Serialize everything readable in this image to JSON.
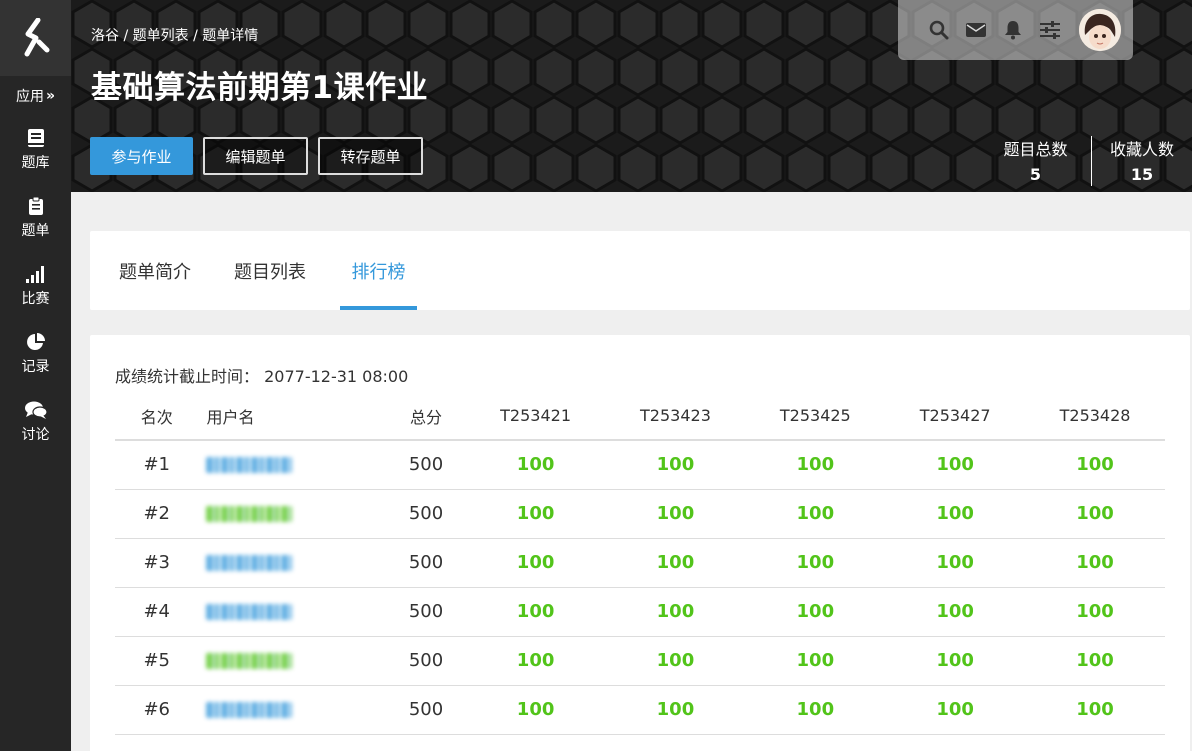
{
  "sidebar": {
    "apps_label": "应用",
    "items": [
      {
        "label": "题库",
        "icon": "book-icon"
      },
      {
        "label": "题单",
        "icon": "clipboard-icon"
      },
      {
        "label": "比赛",
        "icon": "signal-bars-icon"
      },
      {
        "label": "记录",
        "icon": "pie-chart-icon"
      },
      {
        "label": "讨论",
        "icon": "chat-bubbles-icon"
      }
    ]
  },
  "header": {
    "breadcrumb": "洛谷 / 题单列表 / 题单详情",
    "title": "基础算法前期第1课作业",
    "buttons": {
      "join": "参与作业",
      "edit": "编辑题单",
      "save": "转存题单"
    },
    "stats": [
      {
        "label": "题目总数",
        "value": "5"
      },
      {
        "label": "收藏人数",
        "value": "15"
      }
    ],
    "topbar_icons": [
      "search-icon",
      "mail-icon",
      "bell-icon",
      "sliders-icon",
      "avatar"
    ]
  },
  "tabs": [
    "题单简介",
    "题目列表",
    "排行榜"
  ],
  "active_tab": "排行榜",
  "ranking": {
    "cutoff_label": "成绩统计截止时间：",
    "cutoff_time": "2077-12-31 08:00",
    "columns": [
      "名次",
      "用户名",
      "总分",
      "T253421",
      "T253423",
      "T253425",
      "T253427",
      "T253428"
    ],
    "rows": [
      {
        "rank": "#1",
        "user_color": "#3498db",
        "total": "500",
        "scores": [
          "100",
          "100",
          "100",
          "100",
          "100"
        ]
      },
      {
        "rank": "#2",
        "user_color": "#52c41a",
        "total": "500",
        "scores": [
          "100",
          "100",
          "100",
          "100",
          "100"
        ]
      },
      {
        "rank": "#3",
        "user_color": "#3498db",
        "total": "500",
        "scores": [
          "100",
          "100",
          "100",
          "100",
          "100"
        ]
      },
      {
        "rank": "#4",
        "user_color": "#3498db",
        "total": "500",
        "scores": [
          "100",
          "100",
          "100",
          "100",
          "100"
        ]
      },
      {
        "rank": "#5",
        "user_color": "#52c41a",
        "total": "500",
        "scores": [
          "100",
          "100",
          "100",
          "100",
          "100"
        ]
      },
      {
        "rank": "#6",
        "user_color": "#3498db",
        "total": "500",
        "scores": [
          "100",
          "100",
          "100",
          "100",
          "100"
        ]
      }
    ]
  },
  "colors": {
    "accent": "#3498db",
    "score": "#52c41a",
    "sidebar_bg": "#262626"
  }
}
